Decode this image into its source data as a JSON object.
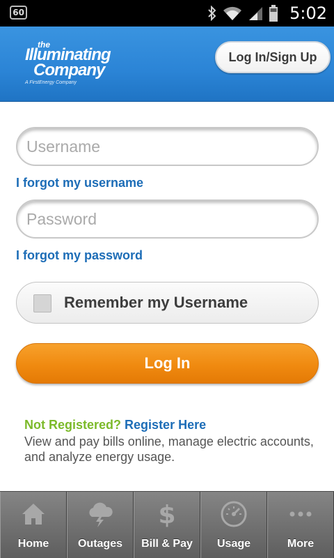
{
  "status_bar": {
    "notification_badge": "60",
    "time": "5:02",
    "icons": [
      "bluetooth-icon",
      "wifi-icon",
      "signal-icon",
      "battery-icon"
    ]
  },
  "header": {
    "logo": {
      "the": "the",
      "line1": "Illuminating",
      "line2": "Company",
      "sub": "A FirstEnergy Company"
    },
    "login_signup_label": "Log In/Sign Up"
  },
  "form": {
    "username_placeholder": "Username",
    "username_value": "",
    "forgot_username": "I forgot my username",
    "password_placeholder": "Password",
    "password_value": "",
    "forgot_password": "I forgot my password",
    "remember_label": "Remember my Username",
    "remember_checked": false,
    "login_label": "Log In"
  },
  "register": {
    "question": "Not Registered?",
    "link": "Register Here",
    "description": "View and pay bills online, manage electric accounts, and analyze energy usage."
  },
  "tabs": [
    {
      "label": "Home",
      "icon": "home-icon"
    },
    {
      "label": "Outages",
      "icon": "storm-cloud-icon"
    },
    {
      "label": "Bill & Pay",
      "icon": "dollar-icon"
    },
    {
      "label": "Usage",
      "icon": "gauge-icon"
    },
    {
      "label": "More",
      "icon": "more-dots-icon"
    }
  ],
  "colors": {
    "header_blue": "#2b84d6",
    "link_blue": "#1d6db7",
    "accent_orange": "#f08a10",
    "register_green": "#7cba2a",
    "tabbar_gray": "#6e6e6e"
  }
}
